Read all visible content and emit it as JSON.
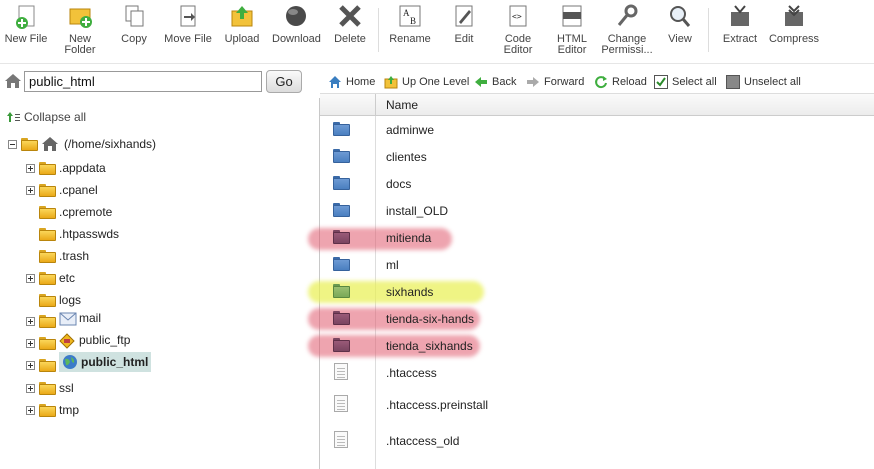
{
  "toolbar": {
    "buttons": [
      {
        "label": "New File",
        "icon": "new-file-icon"
      },
      {
        "label": "New\nFolder",
        "icon": "new-folder-icon"
      },
      {
        "label": "Copy",
        "icon": "copy-icon"
      },
      {
        "label": "Move File",
        "icon": "move-file-icon"
      },
      {
        "label": "Upload",
        "icon": "upload-icon"
      },
      {
        "label": "Download",
        "icon": "download-icon"
      },
      {
        "label": "Delete",
        "icon": "delete-icon"
      },
      {
        "label": "Rename",
        "icon": "rename-icon"
      },
      {
        "label": "Edit",
        "icon": "edit-icon"
      },
      {
        "label": "Code\nEditor",
        "icon": "code-editor-icon"
      },
      {
        "label": "HTML\nEditor",
        "icon": "html-editor-icon"
      },
      {
        "label": "Change\nPermissi...",
        "icon": "change-permissions-icon"
      },
      {
        "label": "View",
        "icon": "view-icon"
      },
      {
        "label": "Extract",
        "icon": "extract-icon"
      },
      {
        "label": "Compress",
        "icon": "compress-icon"
      }
    ]
  },
  "address": {
    "path_value": "public_html",
    "go_label": "Go"
  },
  "tree": {
    "collapse_label": "Collapse all",
    "root_label": "(/home/sixhands)",
    "items": [
      {
        "label": ".appdata"
      },
      {
        "label": ".cpanel"
      },
      {
        "label": ".cpremote"
      },
      {
        "label": ".htpasswds"
      },
      {
        "label": ".trash"
      },
      {
        "label": "etc"
      },
      {
        "label": "logs"
      },
      {
        "label": "mail"
      },
      {
        "label": "public_ftp"
      },
      {
        "label": "public_html"
      },
      {
        "label": "ssl"
      },
      {
        "label": "tmp"
      }
    ]
  },
  "nav": {
    "home": "Home",
    "up": "Up One Level",
    "back": "Back",
    "forward": "Forward",
    "reload": "Reload",
    "select_all": "Select all",
    "unselect_all": "Unselect all"
  },
  "files": {
    "header_name": "Name",
    "rows": [
      {
        "name": "adminwe",
        "type": "folder"
      },
      {
        "name": "clientes",
        "type": "folder"
      },
      {
        "name": "docs",
        "type": "folder"
      },
      {
        "name": "install_OLD",
        "type": "folder"
      },
      {
        "name": "mitienda",
        "type": "folder",
        "highlight": "#e05a6e"
      },
      {
        "name": "ml",
        "type": "folder"
      },
      {
        "name": "sixhands",
        "type": "folder",
        "highlight": "#e8f050"
      },
      {
        "name": "tienda-six-hands",
        "type": "folder",
        "highlight": "#e05a6e"
      },
      {
        "name": "tienda_sixhands",
        "type": "folder",
        "highlight": "#e05a6e"
      },
      {
        "name": ".htaccess",
        "type": "file"
      },
      {
        "name": ".htaccess.preinstall",
        "type": "file"
      },
      {
        "name": ".htaccess_old",
        "type": "file"
      }
    ]
  },
  "colors": {
    "folder_blue": "#4a7fc0",
    "folder_yellow": "#eaa918",
    "highlight_red": "#e05a6e",
    "highlight_yellow": "#e8f050",
    "selected_bg": "#cfe2e0"
  }
}
